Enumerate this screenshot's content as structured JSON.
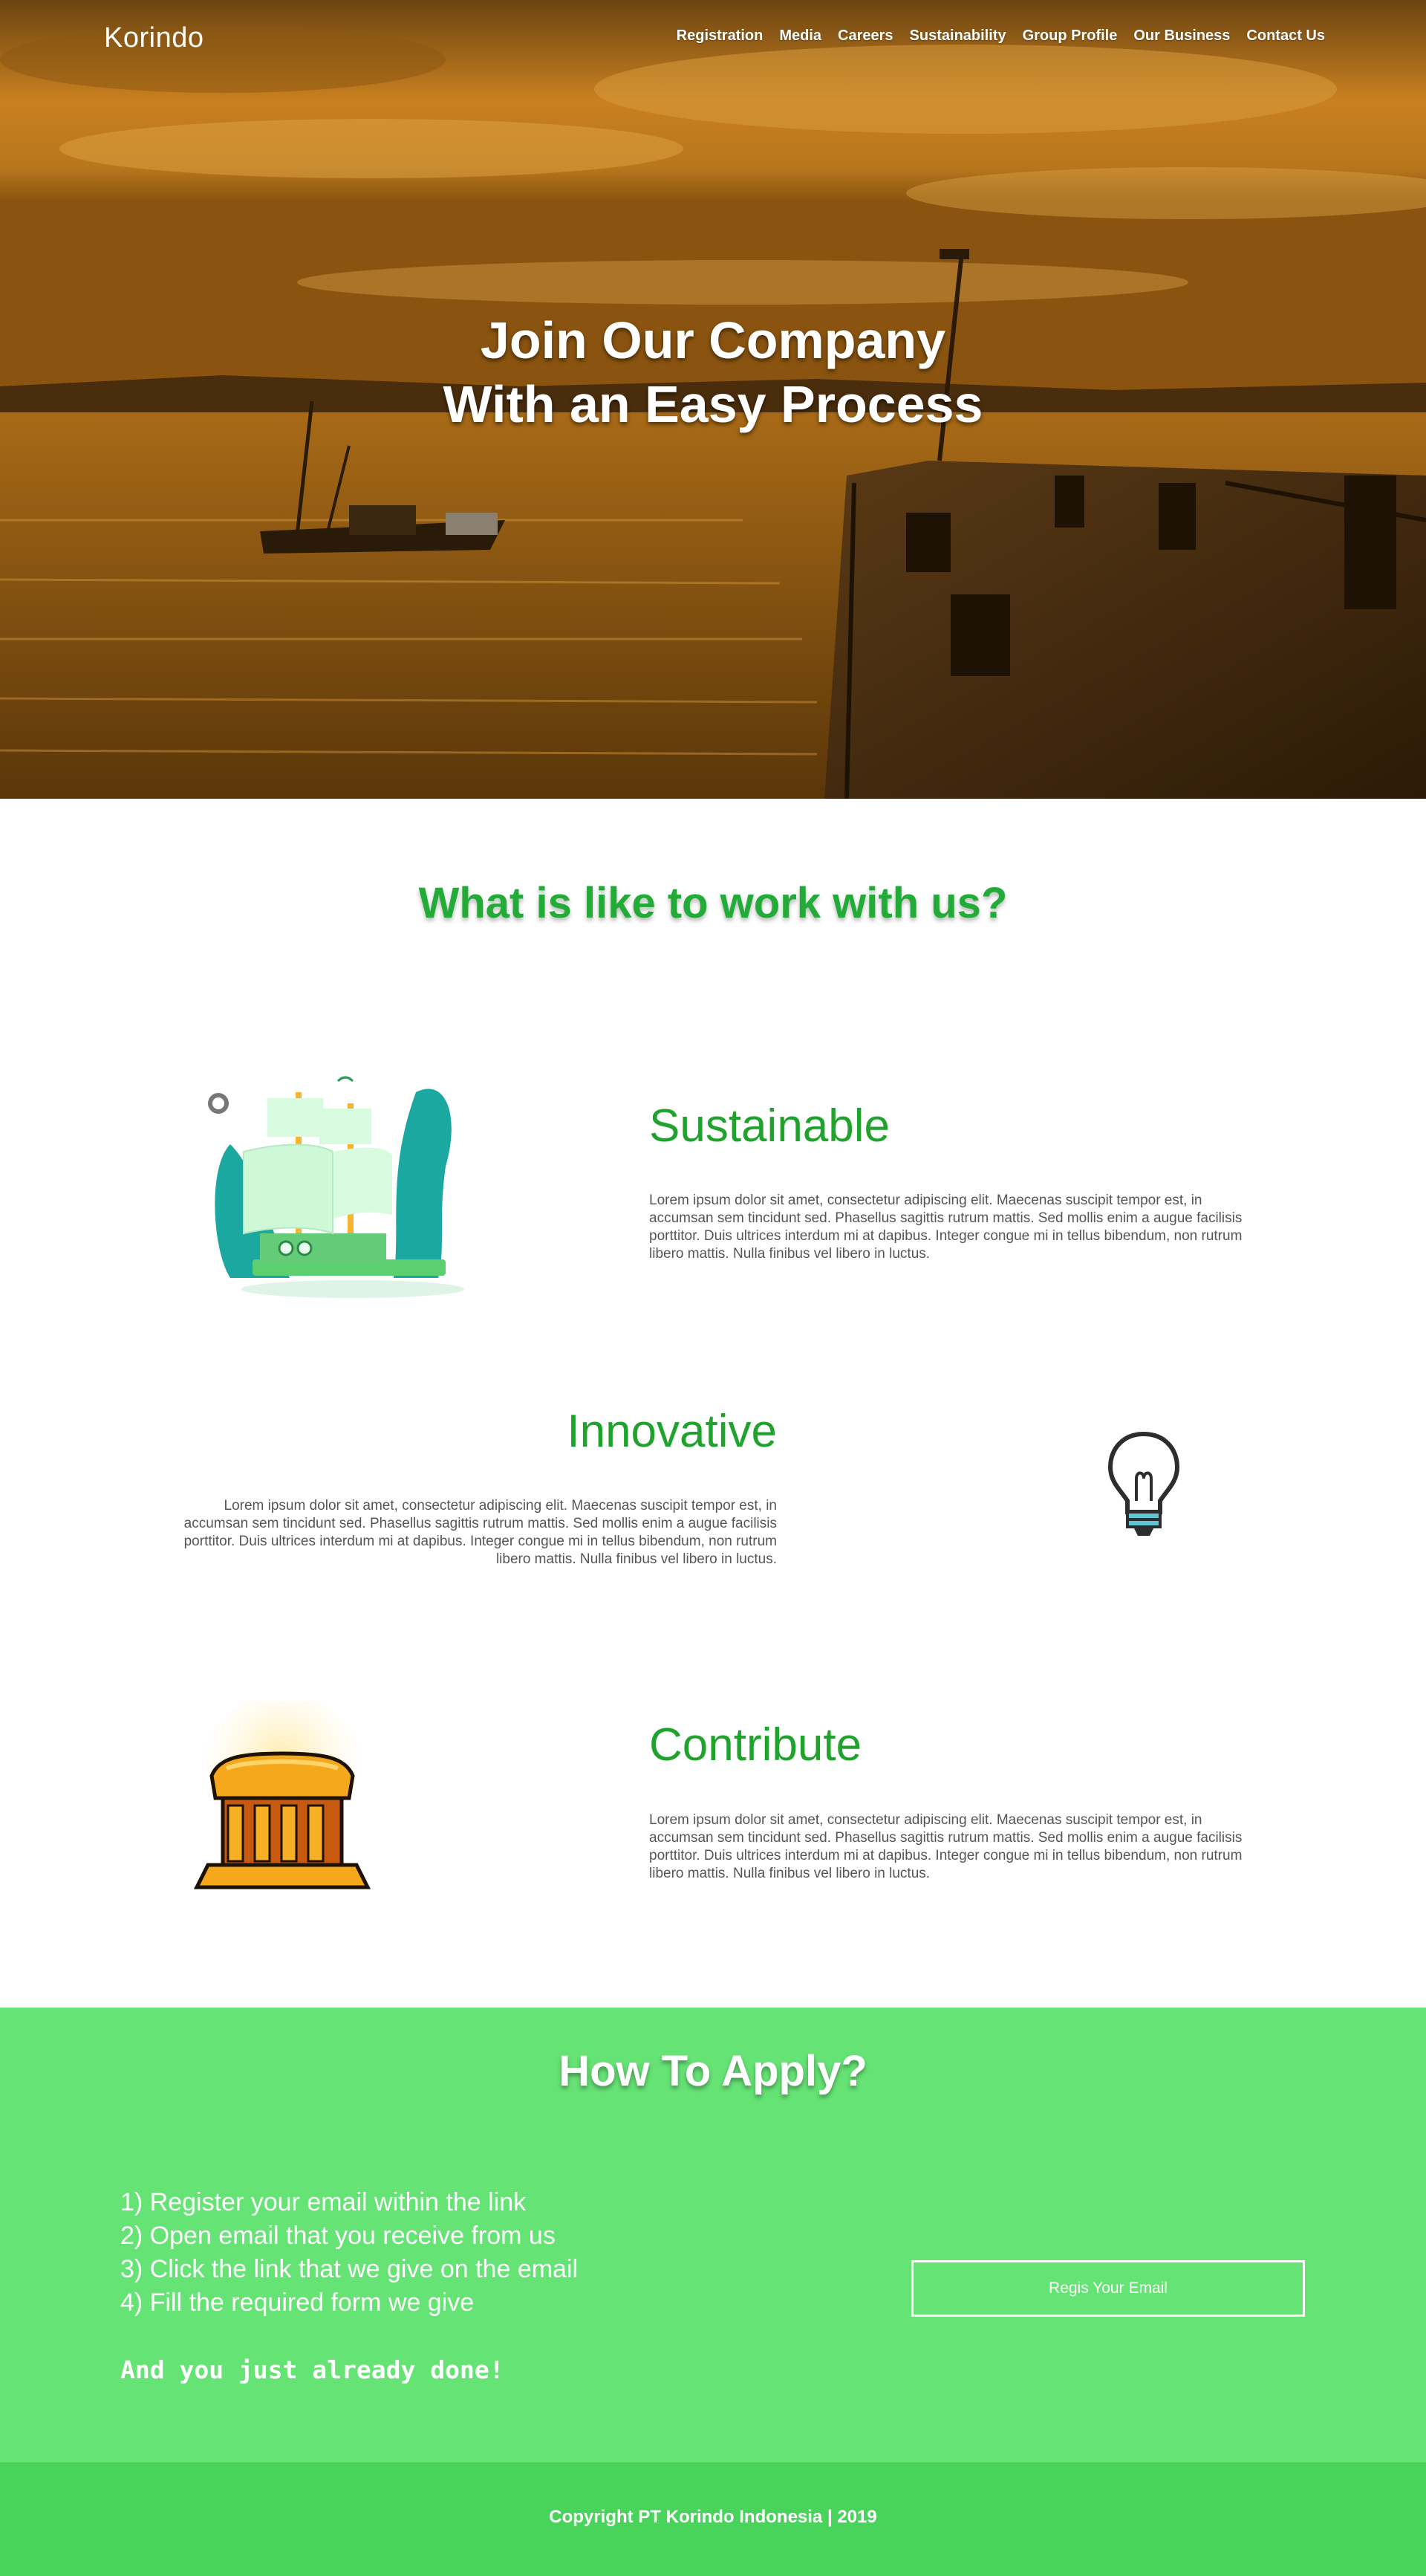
{
  "header": {
    "brand": "Korindo",
    "nav": [
      "Registration",
      "Media",
      "Careers",
      "Sustainability",
      "Group Profile",
      "Our Business",
      "Contact Us"
    ]
  },
  "hero": {
    "title_line1": "Join Our Company",
    "title_line2": "With an Easy Process"
  },
  "why": {
    "title": "What is like to work with us?",
    "features": [
      {
        "title": "Sustainable",
        "icon": "sailing-ship-icon",
        "text": "Lorem ipsum dolor sit amet, consectetur adipiscing elit. Maecenas suscipit tempor est, in accumsan sem tincidunt sed. Phasellus sagittis rutrum mattis. Sed mollis enim a augue facilisis porttitor. Duis ultrices interdum mi at dapibus. Integer congue mi in tellus bibendum, non rutrum libero mattis. Nulla finibus vel libero in luctus."
      },
      {
        "title": "Innovative",
        "icon": "lightbulb-icon",
        "text": "Lorem ipsum dolor sit amet, consectetur adipiscing elit. Maecenas suscipit tempor est, in accumsan sem tincidunt sed. Phasellus sagittis rutrum mattis. Sed mollis enim a augue facilisis porttitor. Duis ultrices interdum mi at dapibus. Integer congue mi in tellus bibendum, non rutrum libero mattis. Nulla finibus vel libero in luctus."
      },
      {
        "title": "Contribute",
        "icon": "bank-building-icon",
        "text": "Lorem ipsum dolor sit amet, consectetur adipiscing elit. Maecenas suscipit tempor est, in accumsan sem tincidunt sed. Phasellus sagittis rutrum mattis. Sed mollis enim a augue facilisis porttitor. Duis ultrices interdum mi at dapibus. Integer congue mi in tellus bibendum, non rutrum libero mattis. Nulla finibus vel libero in luctus."
      }
    ]
  },
  "apply": {
    "title": "How To Apply?",
    "steps": [
      "1) Register your email within the link",
      "2) Open email that you receive from us",
      "3) Click the link that we give on the email",
      "4) Fill the required form we give"
    ],
    "done": "And you just already done!",
    "button": "Regis Your Email"
  },
  "footer": {
    "copyright": "Copyright PT Korindo Indonesia | 2019"
  },
  "colors": {
    "accent_green": "#1fa32d",
    "apply_bg": "#66e375",
    "footer_bg": "#48d45a"
  }
}
